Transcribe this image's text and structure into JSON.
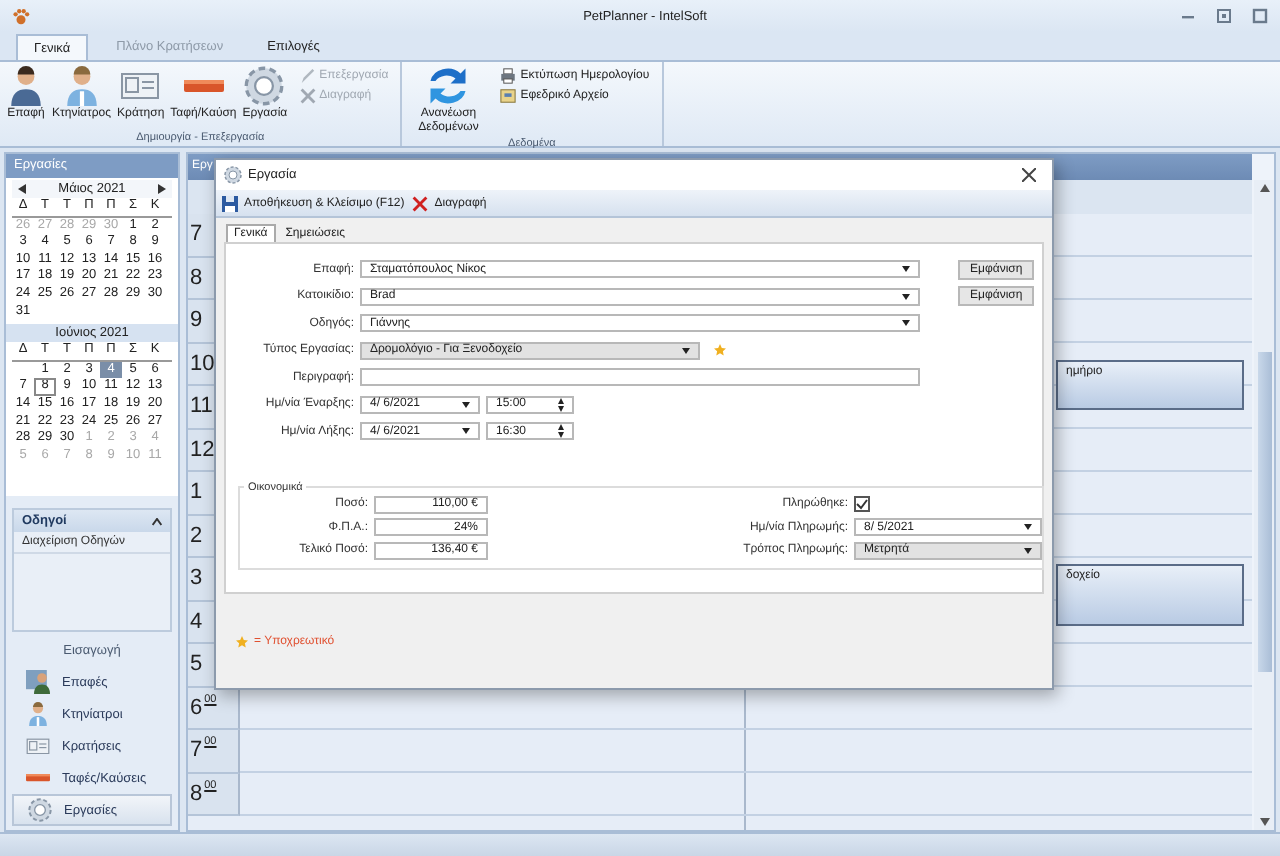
{
  "window": {
    "title": "PetPlanner - IntelSoft"
  },
  "ribbon": {
    "tabs": [
      {
        "label": "Γενικά",
        "selected": true,
        "disabled": false
      },
      {
        "label": "Πλάνο Κρατήσεων",
        "selected": false,
        "disabled": true
      },
      {
        "label": "Επιλογές",
        "selected": false,
        "disabled": false
      }
    ],
    "groups": [
      {
        "label": "Δημιουργία - Επεξεργασία",
        "large": [
          {
            "label": "Επαφή",
            "kind": "person"
          },
          {
            "label": "Κτηνίατρος",
            "kind": "doctor"
          },
          {
            "label": "Κράτηση",
            "kind": "card"
          },
          {
            "label": "Ταφή/Καύση",
            "kind": "bar"
          },
          {
            "label": "Εργασία",
            "kind": "gear"
          }
        ],
        "small": [
          {
            "label": "Επεξεργασία",
            "kind": "pencil",
            "disabled": true
          },
          {
            "label": "Διαγραφή",
            "kind": "cross",
            "disabled": true
          }
        ]
      },
      {
        "label": "Δεδομένα",
        "large": [
          {
            "label": "Ανανέωση Δεδομένων",
            "kind": "refresh"
          }
        ],
        "small": [
          {
            "label": "Εκτύπωση Ημερολογίου",
            "kind": "printer",
            "disabled": false
          },
          {
            "label": "Εφεδρικό Αρχείο",
            "kind": "archive",
            "disabled": false
          }
        ]
      }
    ]
  },
  "sidebar": {
    "title": "Εργασίες",
    "months": [
      {
        "title": "Μάιος 2021",
        "arrows": true,
        "weekdays": [
          "Δ",
          "Τ",
          "Τ",
          "Π",
          "Π",
          "Σ",
          "Κ"
        ],
        "weeks": [
          [
            {
              "day": "26",
              "other_month": true,
              "selected": false,
              "today": false
            },
            {
              "day": "27",
              "other_month": true,
              "selected": false,
              "today": false
            },
            {
              "day": "28",
              "other_month": true,
              "selected": false,
              "today": false
            },
            {
              "day": "29",
              "other_month": true,
              "selected": false,
              "today": false
            },
            {
              "day": "30",
              "other_month": true,
              "selected": false,
              "today": false
            },
            {
              "day": "1",
              "other_month": false,
              "selected": false,
              "today": false
            },
            {
              "day": "2",
              "other_month": false,
              "selected": false,
              "today": false
            }
          ],
          [
            {
              "day": "3",
              "other_month": false,
              "selected": false,
              "today": false
            },
            {
              "day": "4",
              "other_month": false,
              "selected": false,
              "today": false
            },
            {
              "day": "5",
              "other_month": false,
              "selected": false,
              "today": false
            },
            {
              "day": "6",
              "other_month": false,
              "selected": false,
              "today": false
            },
            {
              "day": "7",
              "other_month": false,
              "selected": false,
              "today": false
            },
            {
              "day": "8",
              "other_month": false,
              "selected": false,
              "today": false
            },
            {
              "day": "9",
              "other_month": false,
              "selected": false,
              "today": false
            }
          ],
          [
            {
              "day": "10",
              "other_month": false,
              "selected": false,
              "today": false
            },
            {
              "day": "11",
              "other_month": false,
              "selected": false,
              "today": false
            },
            {
              "day": "12",
              "other_month": false,
              "selected": false,
              "today": false
            },
            {
              "day": "13",
              "other_month": false,
              "selected": false,
              "today": false
            },
            {
              "day": "14",
              "other_month": false,
              "selected": false,
              "today": false
            },
            {
              "day": "15",
              "other_month": false,
              "selected": false,
              "today": false
            },
            {
              "day": "16",
              "other_month": false,
              "selected": false,
              "today": false
            }
          ],
          [
            {
              "day": "17",
              "other_month": false,
              "selected": false,
              "today": false
            },
            {
              "day": "18",
              "other_month": false,
              "selected": false,
              "today": false
            },
            {
              "day": "19",
              "other_month": false,
              "selected": false,
              "today": false
            },
            {
              "day": "20",
              "other_month": false,
              "selected": false,
              "today": false
            },
            {
              "day": "21",
              "other_month": false,
              "selected": false,
              "today": false
            },
            {
              "day": "22",
              "other_month": false,
              "selected": false,
              "today": false
            },
            {
              "day": "23",
              "other_month": false,
              "selected": false,
              "today": false
            }
          ],
          [
            {
              "day": "24",
              "other_month": false,
              "selected": false,
              "today": false
            },
            {
              "day": "25",
              "other_month": false,
              "selected": false,
              "today": false
            },
            {
              "day": "26",
              "other_month": false,
              "selected": false,
              "today": false
            },
            {
              "day": "27",
              "other_month": false,
              "selected": false,
              "today": false
            },
            {
              "day": "28",
              "other_month": false,
              "selected": false,
              "today": false
            },
            {
              "day": "29",
              "other_month": false,
              "selected": false,
              "today": false
            },
            {
              "day": "30",
              "other_month": false,
              "selected": false,
              "today": false
            }
          ],
          [
            {
              "day": "31",
              "other_month": false,
              "selected": false,
              "today": false
            }
          ]
        ]
      },
      {
        "title": "Ιούνιος 2021",
        "arrows": false,
        "weekdays": [
          "Δ",
          "Τ",
          "Τ",
          "Π",
          "Π",
          "Σ",
          "Κ"
        ],
        "weeks": [
          [
            {
              "day": "1",
              "other_month": false,
              "selected": false,
              "today": false
            },
            {
              "day": "2",
              "other_month": false,
              "selected": false,
              "today": false
            },
            {
              "day": "3",
              "other_month": false,
              "selected": false,
              "today": false
            },
            {
              "day": "4",
              "other_month": false,
              "selected": true,
              "today": false
            },
            {
              "day": "5",
              "other_month": false,
              "selected": false,
              "today": false
            },
            {
              "day": "6",
              "other_month": false,
              "selected": false,
              "today": false
            }
          ],
          [
            {
              "day": "7",
              "other_month": false,
              "selected": false,
              "today": false
            },
            {
              "day": "8",
              "other_month": false,
              "selected": false,
              "today": true
            },
            {
              "day": "9",
              "other_month": false,
              "selected": false,
              "today": false
            },
            {
              "day": "10",
              "other_month": false,
              "selected": false,
              "today": false
            },
            {
              "day": "11",
              "other_month": false,
              "selected": false,
              "today": false
            },
            {
              "day": "12",
              "other_month": false,
              "selected": false,
              "today": false
            },
            {
              "day": "13",
              "other_month": false,
              "selected": false,
              "today": false
            }
          ],
          [
            {
              "day": "14",
              "other_month": false,
              "selected": false,
              "today": false
            },
            {
              "day": "15",
              "other_month": false,
              "selected": false,
              "today": false
            },
            {
              "day": "16",
              "other_month": false,
              "selected": false,
              "today": false
            },
            {
              "day": "17",
              "other_month": false,
              "selected": false,
              "today": false
            },
            {
              "day": "18",
              "other_month": false,
              "selected": false,
              "today": false
            },
            {
              "day": "19",
              "other_month": false,
              "selected": false,
              "today": false
            },
            {
              "day": "20",
              "other_month": false,
              "selected": false,
              "today": false
            }
          ],
          [
            {
              "day": "21",
              "other_month": false,
              "selected": false,
              "today": false
            },
            {
              "day": "22",
              "other_month": false,
              "selected": false,
              "today": false
            },
            {
              "day": "23",
              "other_month": false,
              "selected": false,
              "today": false
            },
            {
              "day": "24",
              "other_month": false,
              "selected": false,
              "today": false
            },
            {
              "day": "25",
              "other_month": false,
              "selected": false,
              "today": false
            },
            {
              "day": "26",
              "other_month": false,
              "selected": false,
              "today": false
            },
            {
              "day": "27",
              "other_month": false,
              "selected": false,
              "today": false
            }
          ],
          [
            {
              "day": "28",
              "other_month": false,
              "selected": false,
              "today": false
            },
            {
              "day": "29",
              "other_month": false,
              "selected": false,
              "today": false
            },
            {
              "day": "30",
              "other_month": false,
              "selected": false,
              "today": false
            },
            {
              "day": "1",
              "other_month": true,
              "selected": false,
              "today": false
            },
            {
              "day": "2",
              "other_month": true,
              "selected": false,
              "today": false
            },
            {
              "day": "3",
              "other_month": true,
              "selected": false,
              "today": false
            },
            {
              "day": "4",
              "other_month": true,
              "selected": false,
              "today": false
            }
          ],
          [
            {
              "day": "5",
              "other_month": true,
              "selected": false,
              "today": false
            },
            {
              "day": "6",
              "other_month": true,
              "selected": false,
              "today": false
            },
            {
              "day": "7",
              "other_month": true,
              "selected": false,
              "today": false
            },
            {
              "day": "8",
              "other_month": true,
              "selected": false,
              "today": false
            },
            {
              "day": "9",
              "other_month": true,
              "selected": false,
              "today": false
            },
            {
              "day": "10",
              "other_month": true,
              "selected": false,
              "today": false
            },
            {
              "day": "11",
              "other_month": true,
              "selected": false,
              "today": false
            }
          ]
        ]
      }
    ],
    "panel": {
      "title": "Οδηγοί",
      "expanded": true,
      "items": [
        "Διαχείριση Οδηγών"
      ]
    },
    "nav_title": "Εισαγωγή",
    "nav": [
      {
        "label": "Επαφές",
        "kind": "contacts",
        "selected": false
      },
      {
        "label": "Κτηνίατροι",
        "kind": "doctor",
        "selected": false
      },
      {
        "label": "Κρατήσεις",
        "kind": "card",
        "selected": false
      },
      {
        "label": "Ταφές/Καύσεις",
        "kind": "bar",
        "selected": false
      },
      {
        "label": "Εργασίες",
        "kind": "gear",
        "selected": true
      }
    ]
  },
  "calendar": {
    "tab": "Εργ",
    "hours": [
      {
        "hour": "7"
      },
      {
        "hour": "8"
      },
      {
        "hour": "9"
      },
      {
        "hour": "10"
      },
      {
        "hour": "11"
      },
      {
        "hour": "12"
      },
      {
        "hour": "1"
      },
      {
        "hour": "2"
      },
      {
        "hour": "3"
      },
      {
        "hour": "4"
      },
      {
        "hour": "5"
      },
      {
        "hour": "6",
        "minutes": "00"
      },
      {
        "hour": "7",
        "minutes": "00"
      },
      {
        "hour": "8",
        "minutes": "00"
      }
    ],
    "appointments": [
      {
        "text": "ημήριο"
      },
      {
        "text": "δοχείο"
      }
    ]
  },
  "dialog": {
    "title": "Εργασία",
    "toolbar": [
      {
        "label": "Αποθήκευση & Κλείσιμο (F12)",
        "kind": "save"
      },
      {
        "label": "Διαγραφή",
        "kind": "cross"
      }
    ],
    "tabs": [
      {
        "label": "Γενικά",
        "selected": true
      },
      {
        "label": "Σημειώσεις",
        "selected": false
      }
    ],
    "fields": [
      {
        "label": "Επαφή:",
        "kind": "combo",
        "value": "Σταματόπουλος Νίκος",
        "button": "Εμφάνιση",
        "required": false
      },
      {
        "label": "Κατοικίδιο:",
        "kind": "combo",
        "value": "Brad",
        "button": "Εμφάνιση",
        "required": false
      },
      {
        "label": "Οδηγός:",
        "kind": "combo",
        "value": "Γιάννης",
        "required": false
      },
      {
        "label": "Τύπος Εργασίας:",
        "kind": "short_combo",
        "value": "Δρομολόγιο - Για Ξενοδοχείο",
        "required": true
      },
      {
        "label": "Περιγραφή:",
        "kind": "text",
        "required": false
      },
      {
        "label": "Ημ/νία Έναρξης:",
        "kind": "datetime",
        "value": "4/ 6/2021",
        "time": "15:00",
        "required": false
      },
      {
        "label": "Ημ/νία Λήξης:",
        "kind": "datetime",
        "value": "4/ 6/2021",
        "time": "16:30",
        "required": false
      }
    ],
    "finance": {
      "title": "Οικονομικά",
      "left": [
        {
          "label": "Ποσό:",
          "value": "110,00 €"
        },
        {
          "label": "Φ.Π.Α.:",
          "value": "24%"
        },
        {
          "label": "Τελικό Ποσό:",
          "value": "136,40 €"
        }
      ],
      "right": [
        {
          "label": "Πληρώθηκε:",
          "kind": "check",
          "checked": true
        },
        {
          "label": "Ημ/νία Πληρωμής:",
          "kind": "combo",
          "value": "8/ 5/2021"
        },
        {
          "label": "Τρόπος Πληρωμής:",
          "kind": "short_combo",
          "value": "Μετρητά"
        }
      ]
    },
    "legend": "= Υποχρεωτικό"
  }
}
